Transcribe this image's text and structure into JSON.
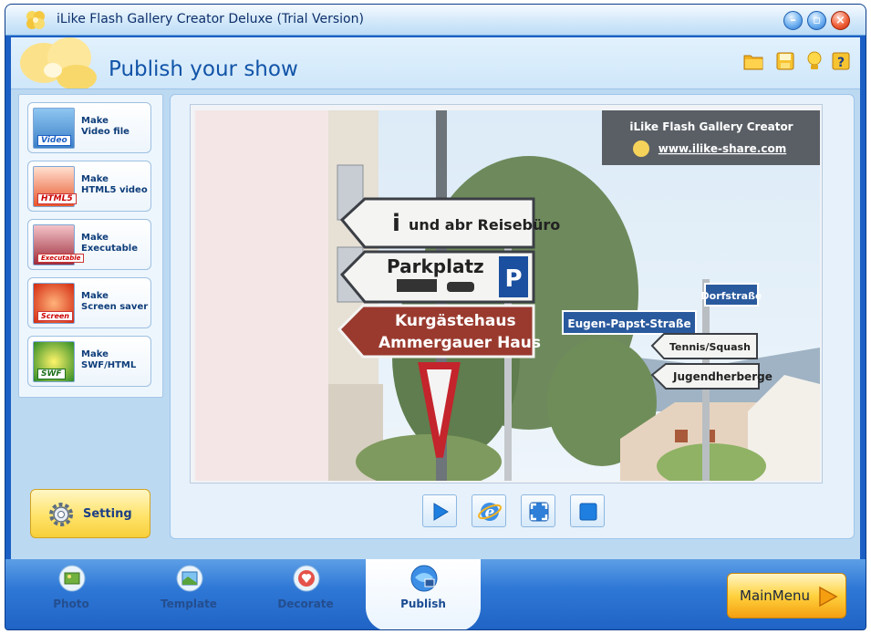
{
  "window": {
    "title": "iLike Flash Gallery Creator Deluxe (Trial Version)"
  },
  "header": {
    "title": "Publish your show",
    "icons": [
      "folder-icon",
      "save-icon",
      "tip-icon",
      "help-icon"
    ],
    "help_glyph": "?"
  },
  "make_options": [
    {
      "label": "Make\nVideo file",
      "badge": "Video"
    },
    {
      "label": "Make\nHTML5 video",
      "badge": "HTML5"
    },
    {
      "label": "Make\nExecutable",
      "badge": "Executable"
    },
    {
      "label": "Make\nScreen saver",
      "badge": "Screen"
    },
    {
      "label": "Make\nSWF/HTML",
      "badge": "SWF"
    }
  ],
  "setting": {
    "label": "Setting"
  },
  "preview": {
    "watermark_title": "iLike Flash Gallery Creator",
    "watermark_url": "www.ilike-share.com",
    "signs": {
      "sign1": "und abr Reisebüro",
      "sign2": "Parkplatz",
      "sign2_symbol": "P",
      "sign3_line1": "Kurgästehaus",
      "sign3_line2": "Ammergauer Haus",
      "sign4": "Eugen-Papst-Straße",
      "sign5": "Dorfstraße",
      "sign6": "Tennis/Squash",
      "sign7": "Jugendherberge"
    }
  },
  "controls": [
    "play-icon",
    "browser-icon",
    "fullscreen-icon",
    "stop-icon"
  ],
  "tabs": [
    {
      "label": "Photo"
    },
    {
      "label": "Template"
    },
    {
      "label": "Decorate"
    },
    {
      "label": "Publish"
    }
  ],
  "main_menu": {
    "label": "MainMenu"
  },
  "colors": {
    "accent": "#1b5fc4",
    "title_text": "#1254a8",
    "button_yellow": "#ffd23f"
  }
}
